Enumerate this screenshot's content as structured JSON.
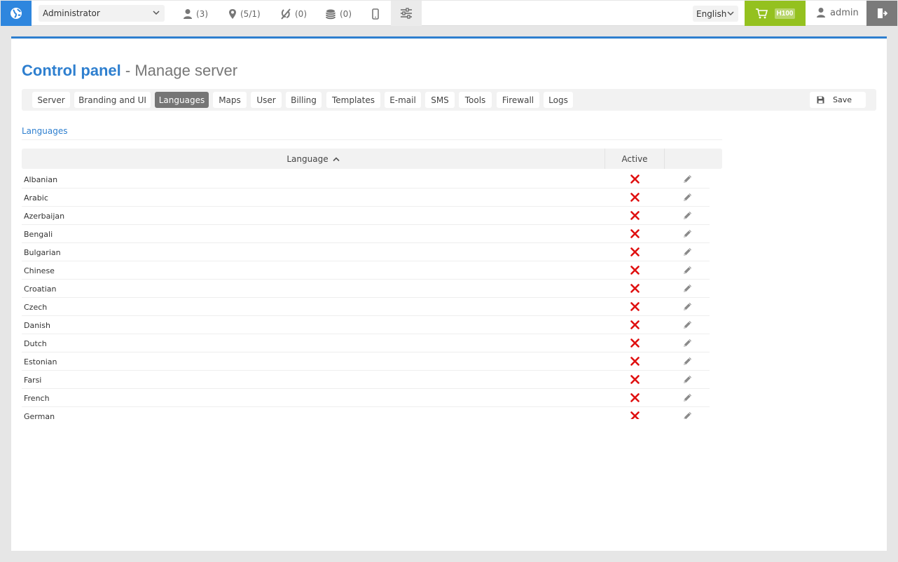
{
  "topbar": {
    "role": "Administrator",
    "users_count": "(3)",
    "objects_count": "(5/1)",
    "events_count": "(0)",
    "billing_count": "(0)",
    "language": "English",
    "cart_badge": "H100",
    "username": "admin"
  },
  "header": {
    "title": "Control panel",
    "subtitle": "- Manage server"
  },
  "tabs": [
    {
      "label": "Server"
    },
    {
      "label": "Branding and UI"
    },
    {
      "label": "Languages"
    },
    {
      "label": "Maps"
    },
    {
      "label": "User"
    },
    {
      "label": "Billing"
    },
    {
      "label": "Templates"
    },
    {
      "label": "E-mail"
    },
    {
      "label": "SMS"
    },
    {
      "label": "Tools"
    },
    {
      "label": "Firewall"
    },
    {
      "label": "Logs"
    }
  ],
  "active_tab": "Languages",
  "save_label": "Save",
  "section_title": "Languages",
  "table": {
    "columns": [
      "Language",
      "Active"
    ],
    "rows": [
      {
        "name": "Albanian"
      },
      {
        "name": "Arabic"
      },
      {
        "name": "Azerbaijan"
      },
      {
        "name": "Bengali"
      },
      {
        "name": "Bulgarian"
      },
      {
        "name": "Chinese"
      },
      {
        "name": "Croatian"
      },
      {
        "name": "Czech"
      },
      {
        "name": "Danish"
      },
      {
        "name": "Dutch"
      },
      {
        "name": "Estonian"
      },
      {
        "name": "Farsi"
      },
      {
        "name": "French"
      },
      {
        "name": "German"
      }
    ]
  },
  "colors": {
    "accent": "#2e7fcf",
    "cart": "#94c11f",
    "inactive_x": "#e01010"
  }
}
